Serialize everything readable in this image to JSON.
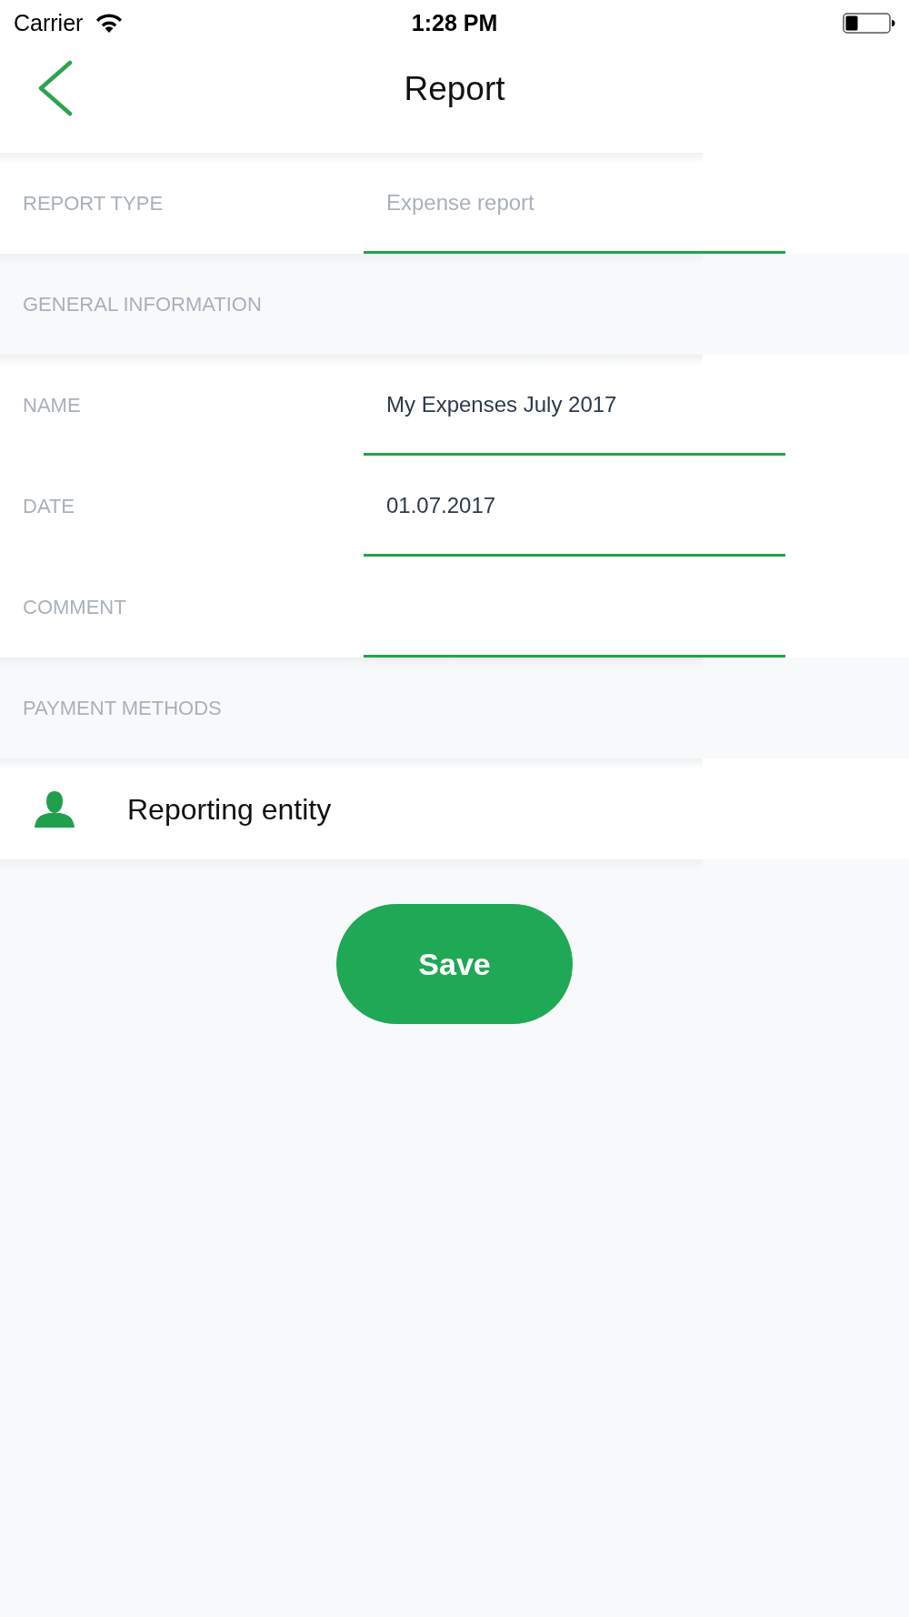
{
  "status_bar": {
    "carrier": "Carrier",
    "time": "1:28 PM"
  },
  "header": {
    "title": "Report"
  },
  "form": [
    {
      "kind": "field",
      "label": "REPORT TYPE",
      "placeholder": "Expense report"
    },
    {
      "kind": "section",
      "title": "GENERAL INFORMATION"
    },
    {
      "kind": "field",
      "label": "NAME",
      "value": "My Expenses July 2017"
    },
    {
      "kind": "field",
      "label": "DATE",
      "value": "01.07.2017"
    },
    {
      "kind": "field",
      "label": "COMMENT"
    },
    {
      "kind": "section",
      "title": "PAYMENT METHODS"
    },
    {
      "kind": "link",
      "label": "Reporting entity"
    }
  ],
  "save_button": {
    "label": "Save"
  }
}
